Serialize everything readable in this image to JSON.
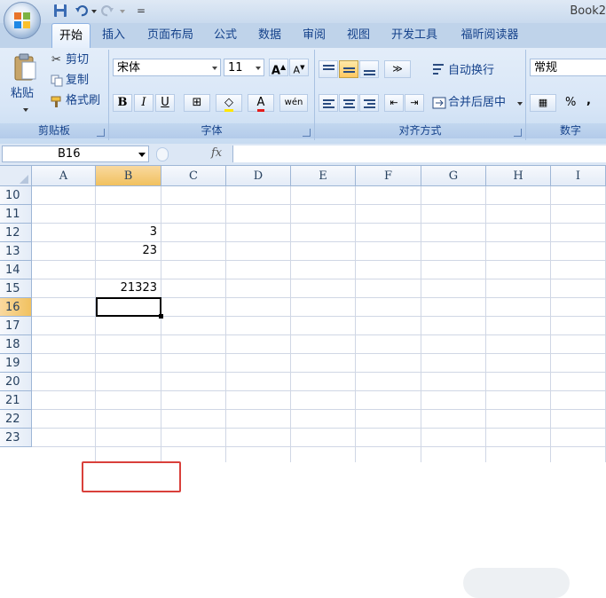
{
  "window": {
    "title": "Book2"
  },
  "ribbon_tabs": [
    "开始",
    "插入",
    "页面布局",
    "公式",
    "数据",
    "审阅",
    "视图",
    "开发工具",
    "福昕阅读器"
  ],
  "clipboard": {
    "paste": "粘贴",
    "cut": "剪切",
    "copy": "复制",
    "format_painter": "格式刷",
    "group": "剪贴板"
  },
  "font": {
    "name": "宋体",
    "size": "11",
    "bold": "B",
    "italic": "I",
    "underline": "U",
    "group": "字体"
  },
  "alignment": {
    "wrap_text": "自动换行",
    "merge_center": "合并后居中",
    "group": "对齐方式"
  },
  "number": {
    "format": "常规",
    "percent": "%",
    "comma": ",",
    "group": "数字"
  },
  "formula_bar": {
    "name_box": "B16",
    "fx": "fx",
    "content": ""
  },
  "columns": [
    "A",
    "B",
    "C",
    "D",
    "E",
    "F",
    "G",
    "H",
    "I"
  ],
  "rows": [
    "10",
    "11",
    "12",
    "13",
    "14",
    "15",
    "16",
    "17",
    "18",
    "19",
    "20",
    "21",
    "22",
    "23"
  ],
  "cells": {
    "B12": "3",
    "B13": "23",
    "B15": "21323"
  },
  "active_cell": "B16",
  "colors": {
    "accent": "#d9403b",
    "header_active": "#f1c15f"
  }
}
